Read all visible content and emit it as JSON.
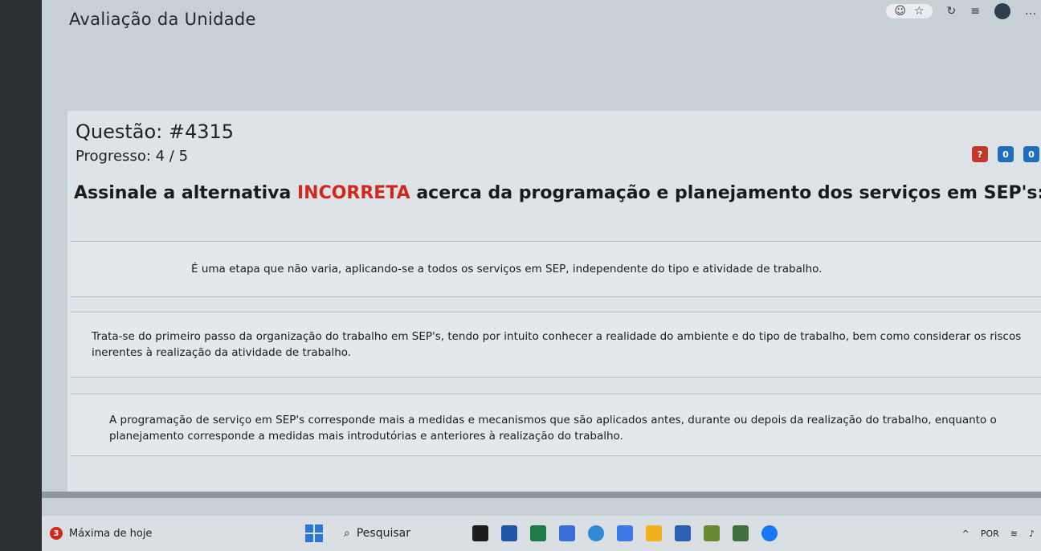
{
  "window": {
    "title": "Avaliação da Unidade"
  },
  "question": {
    "title": "Questão: #4315",
    "progress": "Progresso: 4 / 5",
    "statement_before": "Assinale a alternativa ",
    "statement_highlight": "INCORRETA",
    "statement_after": " acerca da programação e planejamento dos serviços em SEP's:",
    "badges": [
      "?",
      "0",
      "0"
    ]
  },
  "options": [
    {
      "text": "É uma etapa que não varia, aplicando-se a todos os serviços em SEP, independente do tipo e atividade de trabalho."
    },
    {
      "text": "Trata-se do primeiro passo da organização do trabalho em SEP's, tendo por intuito conhecer a realidade do ambiente e do tipo de trabalho, bem como considerar os riscos inerentes à realização da atividade de trabalho."
    },
    {
      "text": "A programação de serviço em SEP's corresponde mais a medidas e mecanismos que são aplicados antes, durante ou depois da realização do trabalho, enquanto o planejamento corresponde a medidas mais introdutórias e anteriores à realização do trabalho."
    }
  ],
  "taskbar": {
    "weather_count": "3",
    "weather_label": "Máxima de hoje",
    "search_label": "Pesquisar",
    "tray_lang": "POR"
  },
  "colors": {
    "accent": "#d0281e",
    "info": "#1e6fb8"
  }
}
